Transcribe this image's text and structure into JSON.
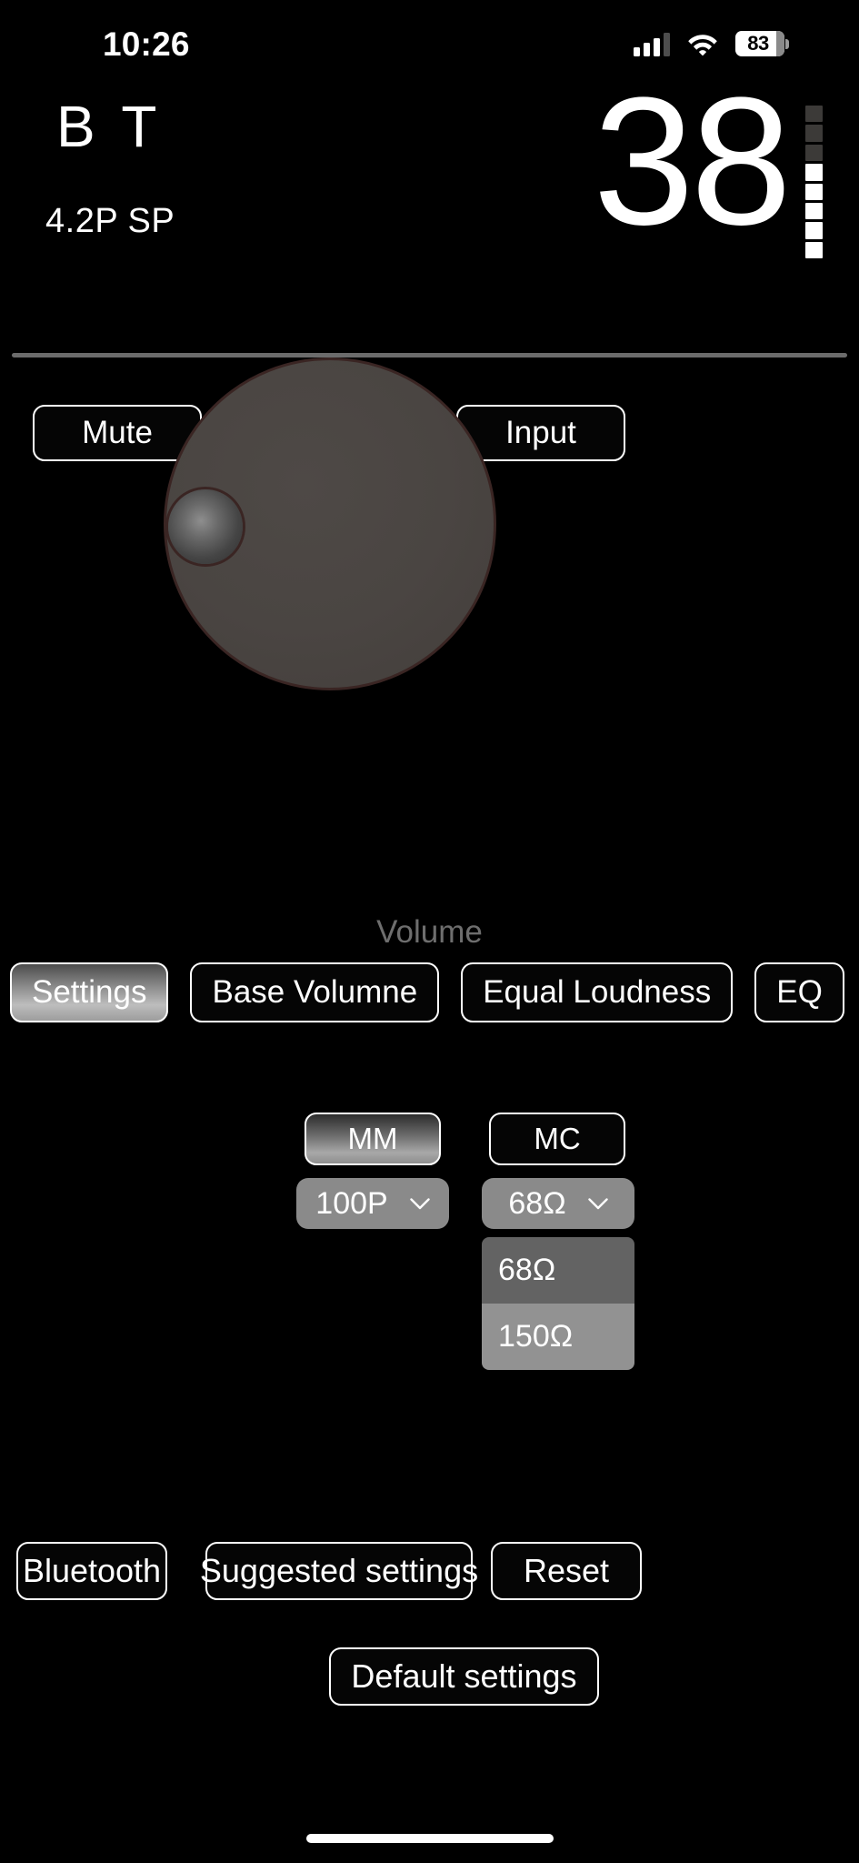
{
  "status_bar": {
    "time": "10:26",
    "cellular_icon": "cellular-signal-icon",
    "wifi_icon": "wifi-icon",
    "battery_icon": "battery-icon",
    "battery_percent": "83"
  },
  "header": {
    "device_name": "B T",
    "device_subtitle": "4.2P SP",
    "volume_value": "38",
    "meter": {
      "name": "volume-level-meter",
      "segments": [
        "off",
        "off",
        "off",
        "on",
        "on",
        "on",
        "on",
        "on"
      ]
    }
  },
  "controls": {
    "mute_label": "Mute",
    "input_label": "Input",
    "knob_label": "Volume",
    "knob_name": "volume-knob"
  },
  "tabs": [
    {
      "label": "Settings",
      "selected": true
    },
    {
      "label": "Base Volumne",
      "selected": false
    },
    {
      "label": "Equal Loudness",
      "selected": false
    },
    {
      "label": "EQ",
      "selected": false
    }
  ],
  "cartridge": {
    "mm_label": "MM",
    "mc_label": "MC",
    "mm_selected": true,
    "capacitance": {
      "value": "100P",
      "chevron": "chevron-down-icon"
    },
    "impedance": {
      "value": "68Ω",
      "chevron": "chevron-down-icon",
      "open": true,
      "options": [
        {
          "label": "68Ω",
          "highlighted": true
        },
        {
          "label": "150Ω",
          "highlighted": false
        }
      ]
    }
  },
  "bottom_buttons": {
    "bluetooth": "Bluetooth",
    "suggested_settings": "Suggested settings",
    "reset": "Reset",
    "default_settings": "Default settings"
  },
  "colors": {
    "background": "#000000",
    "accent_border": "#ffffff",
    "knob_face": "#4a4542",
    "knob_rim": "#3a2523",
    "dropdown_bg": "#8a8a8a",
    "divider": "#6b6b6b",
    "muted_text": "#6e6e6e"
  }
}
